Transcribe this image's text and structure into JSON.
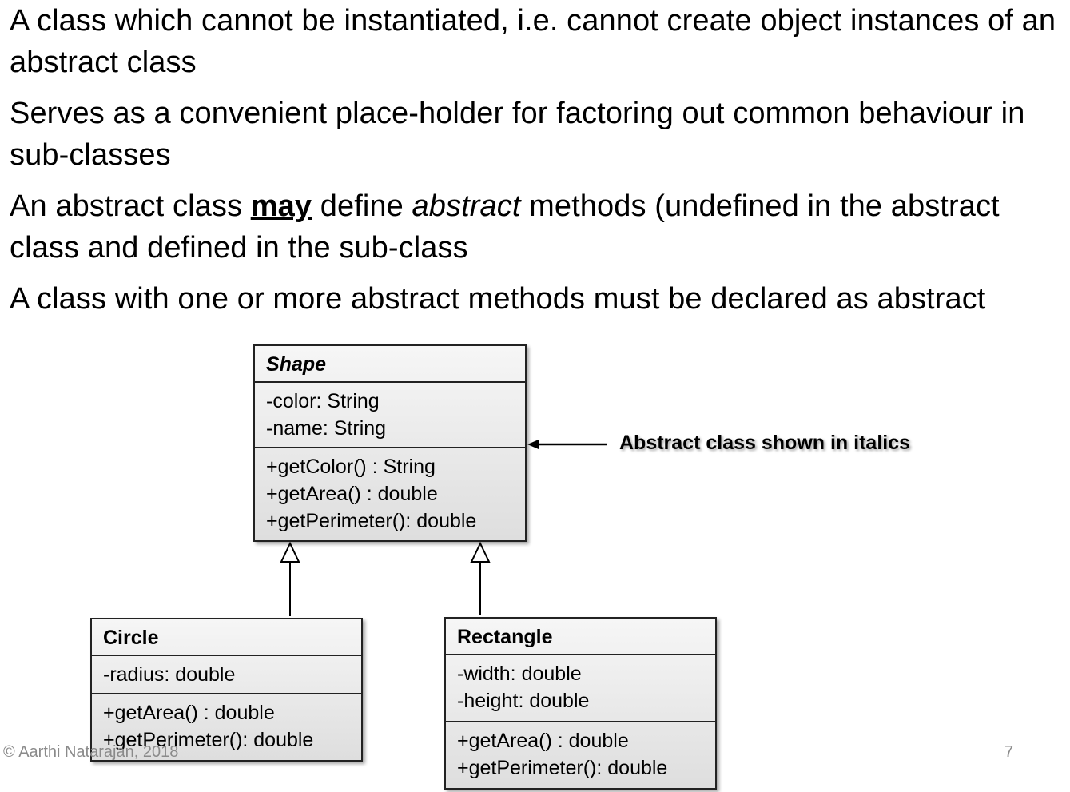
{
  "bullets": {
    "p1": "A class which cannot be instantiated, i.e. cannot create object instances of an abstract class",
    "p2": "Serves as a convenient place-holder for factoring out common behaviour in sub-classes",
    "p3_a": "An abstract class ",
    "p3_b": "may",
    "p3_c": " define ",
    "p3_d": "abstract",
    "p3_e": " methods (undefined in the abstract class and defined in the sub-class",
    "p4": "A class with one or more abstract methods must be declared as abstract"
  },
  "diagram": {
    "shape": {
      "name": "Shape",
      "attributes": [
        "-color: String",
        "-name:  String"
      ],
      "methods": [
        "+getColor() : String",
        "+getArea() :  double",
        "+getPerimeter(): double"
      ]
    },
    "circle": {
      "name": "Circle",
      "attributes": [
        "-radius: double"
      ],
      "methods": [
        "+getArea() :  double",
        "+getPerimeter(): double"
      ]
    },
    "rectangle": {
      "name": "Rectangle",
      "attributes": [
        "-width: double",
        "-height: double"
      ],
      "methods": [
        "+getArea() :  double",
        "+getPerimeter(): double"
      ]
    },
    "annotation": "Abstract class shown in italics"
  },
  "footer": {
    "copyright": "© Aarthi Natarajan, 2018",
    "page_number": "7"
  }
}
